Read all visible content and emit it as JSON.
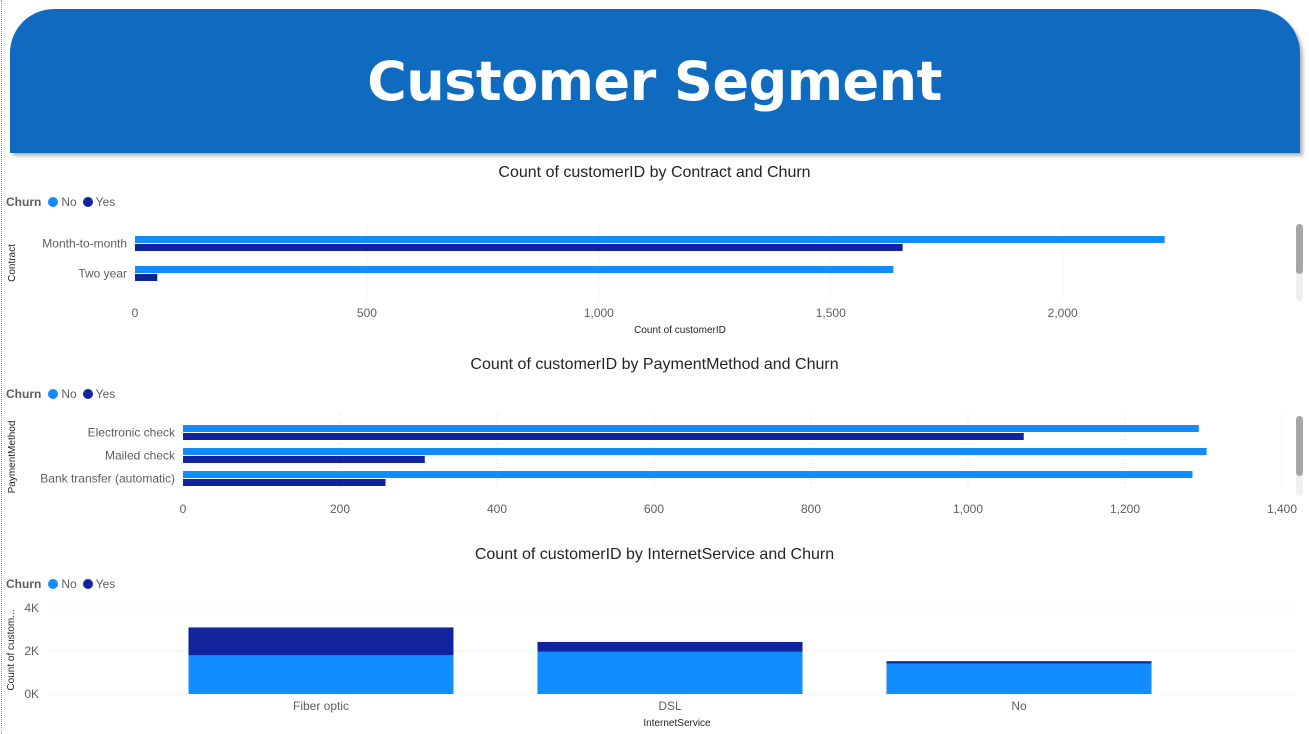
{
  "page": {
    "title": "Customer Segment"
  },
  "colors": {
    "banner": "#0f6bc0",
    "no": "#118dff",
    "yes": "#12239e"
  },
  "legend": {
    "title": "Churn",
    "items": [
      "No",
      "Yes"
    ]
  },
  "chart_data": [
    {
      "type": "bar",
      "orientation": "horizontal",
      "title": "Count of customerID by Contract and Churn",
      "xlabel": "Count of customerID",
      "ylabel": "Contract",
      "categories": [
        "Month-to-month",
        "Two year"
      ],
      "series": [
        {
          "name": "No",
          "values": [
            2220,
            1635
          ]
        },
        {
          "name": "Yes",
          "values": [
            1655,
            48
          ]
        }
      ],
      "xticks": [
        0,
        500,
        1000,
        1500,
        2000
      ],
      "xtick_labels": [
        "0",
        "500",
        "1,000",
        "1,500",
        "2,000"
      ],
      "xlim": [
        0,
        2350
      ],
      "grid": true,
      "legend": "top-left"
    },
    {
      "type": "bar",
      "orientation": "horizontal",
      "title": "Count of customerID by PaymentMethod and Churn",
      "xlabel": "",
      "ylabel": "PaymentMethod",
      "categories": [
        "Electronic check",
        "Mailed check",
        "Bank transfer (automatic)"
      ],
      "series": [
        {
          "name": "No",
          "values": [
            1294,
            1304,
            1286
          ]
        },
        {
          "name": "Yes",
          "values": [
            1071,
            308,
            258
          ]
        }
      ],
      "xticks": [
        0,
        200,
        400,
        600,
        800,
        1000,
        1200,
        1400
      ],
      "xtick_labels": [
        "0",
        "200",
        "400",
        "600",
        "800",
        "1,000",
        "1,200",
        "1,400"
      ],
      "xlim": [
        0,
        1400
      ],
      "grid": true,
      "legend": "top-left"
    },
    {
      "type": "bar",
      "orientation": "vertical",
      "stacked": true,
      "title": "Count of customerID by InternetService and Churn",
      "xlabel": "InternetService",
      "ylabel": "Count of custom...",
      "categories": [
        "Fiber optic",
        "DSL",
        "No"
      ],
      "series": [
        {
          "name": "No",
          "values": [
            1799,
            1962,
            1413
          ]
        },
        {
          "name": "Yes",
          "values": [
            1297,
            459,
            113
          ]
        }
      ],
      "yticks": [
        0,
        2000,
        4000
      ],
      "ytick_labels": [
        "0K",
        "2K",
        "4K"
      ],
      "ylim": [
        0,
        4000
      ],
      "grid": true,
      "legend": "top-left"
    }
  ]
}
